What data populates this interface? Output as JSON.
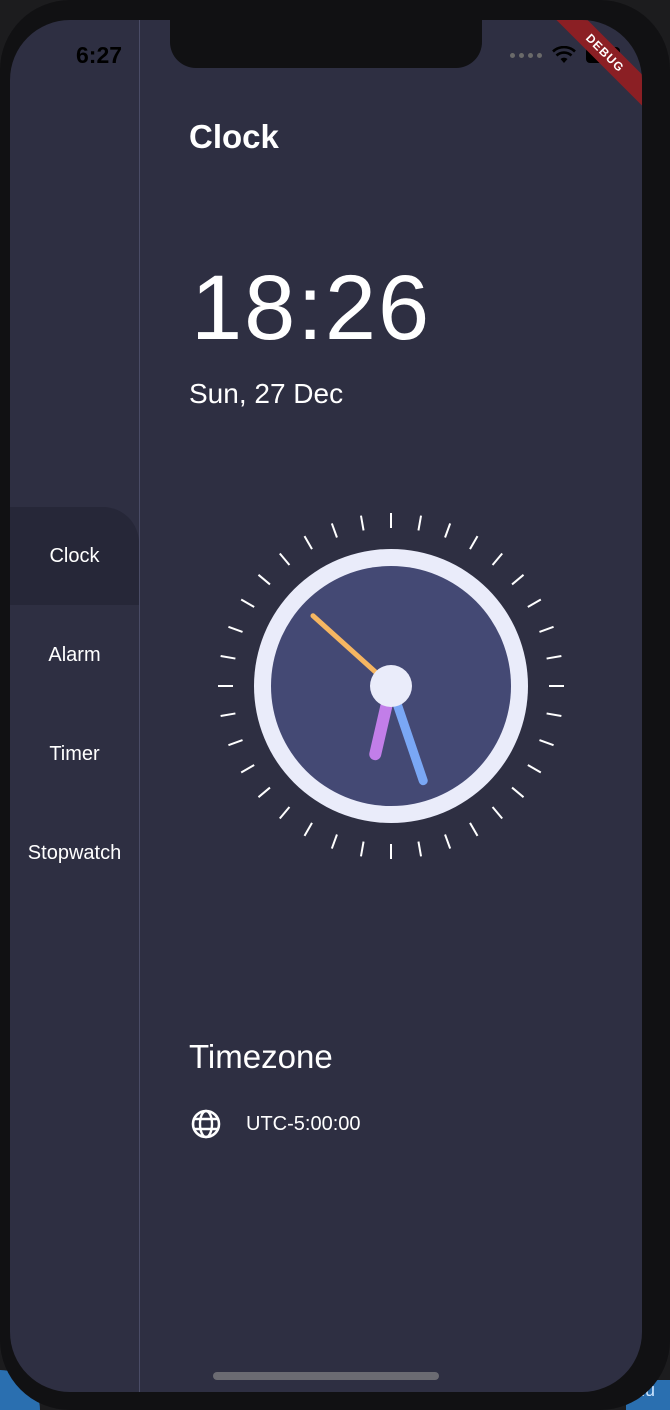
{
  "status_bar": {
    "time": "6:27",
    "debug_label": "DEBUG"
  },
  "sidebar": {
    "items": [
      {
        "label": "Clock",
        "active": true
      },
      {
        "label": "Alarm",
        "active": false
      },
      {
        "label": "Timer",
        "active": false
      },
      {
        "label": "Stopwatch",
        "active": false
      }
    ]
  },
  "main": {
    "title": "Clock",
    "time": "18:26",
    "date": "Sun, 27 Dec",
    "analog_clock": {
      "hours": 18,
      "minutes": 26,
      "seconds": 52
    },
    "timezone_title": "Timezone",
    "timezone_icon": "globe-icon",
    "timezone_value": "UTC-5:00:00"
  },
  "desktop_peek_right": "Flu",
  "colors": {
    "background": "#2e2f42",
    "sidebar_active": "#262738",
    "clock_face": "#444974",
    "clock_ring": "#eaecfa",
    "second_hand": "#f6b661",
    "minute_hand": "#7aa7f5",
    "hour_hand": "#c27ee9"
  }
}
